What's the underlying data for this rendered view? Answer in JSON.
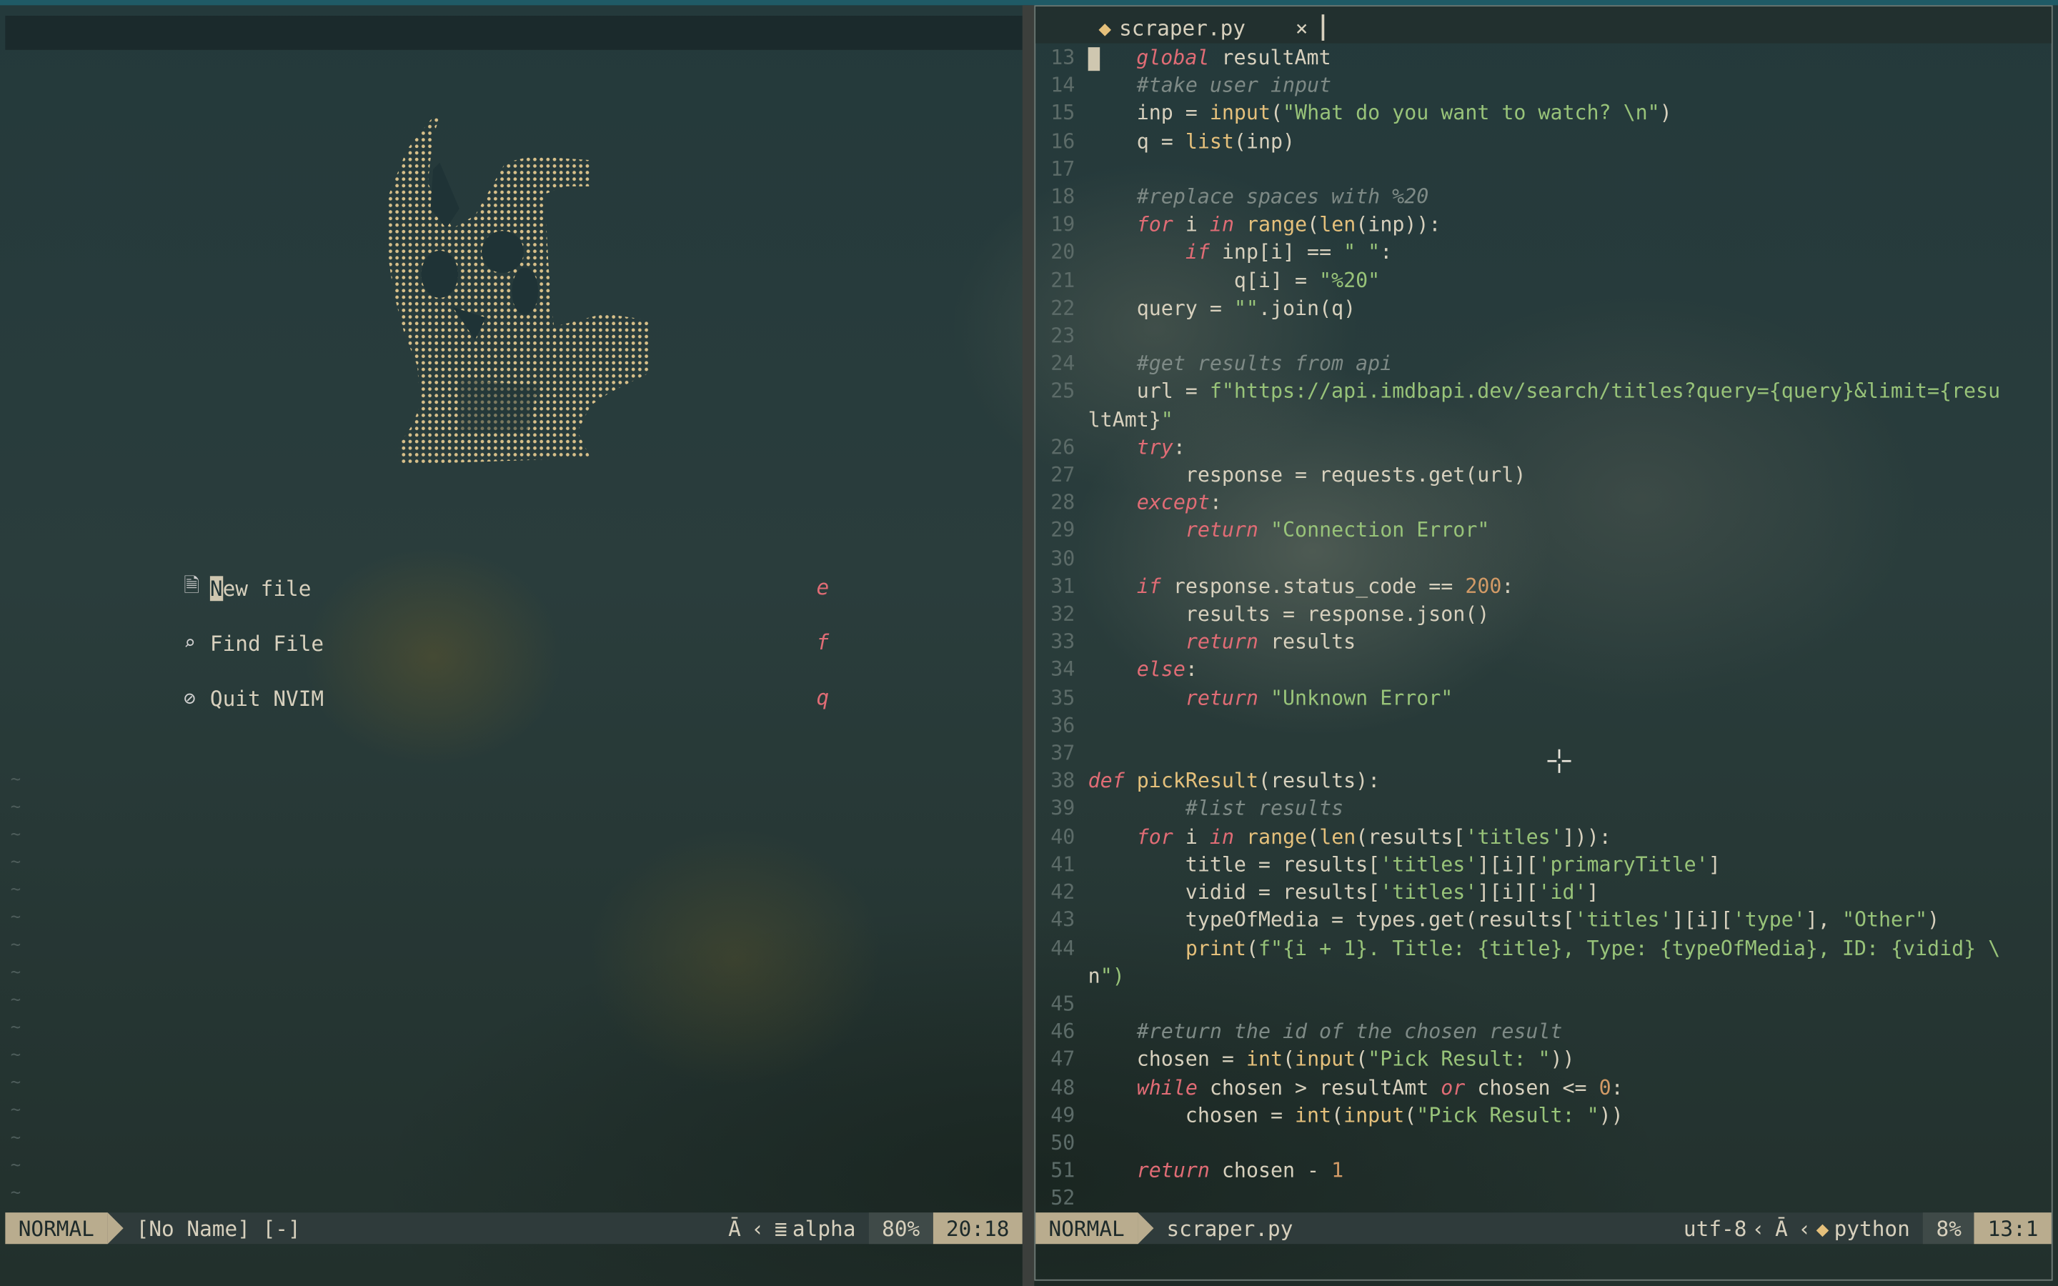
{
  "left_pane": {
    "dashboard": [
      {
        "icon": "file-icon",
        "label": "New file",
        "key": "e"
      },
      {
        "icon": "find-file-icon",
        "label": "Find File",
        "key": "f"
      },
      {
        "icon": "quit-icon",
        "label": "Quit NVIM",
        "key": "q"
      }
    ],
    "status": {
      "mode": "NORMAL",
      "filename": "[No Name] [-]",
      "filetype": "alpha",
      "percent": "80%",
      "position": "20:18"
    }
  },
  "right_pane": {
    "tab": {
      "label": "scraper.py",
      "close": "×"
    },
    "code": [
      {
        "n": "13",
        "text": "    global resultAmt"
      },
      {
        "n": "14",
        "text": "    #take user input"
      },
      {
        "n": "15",
        "text": "    inp = input(\"What do you want to watch? \\n\")"
      },
      {
        "n": "16",
        "text": "    q = list(inp)"
      },
      {
        "n": "17",
        "text": ""
      },
      {
        "n": "18",
        "text": "    #replace spaces with %20"
      },
      {
        "n": "19",
        "text": "    for i in range(len(inp)):"
      },
      {
        "n": "20",
        "text": "        if inp[i] == \" \":"
      },
      {
        "n": "21",
        "text": "            q[i] = \"%20\""
      },
      {
        "n": "22",
        "text": "    query = \"\".join(q)"
      },
      {
        "n": "23",
        "text": ""
      },
      {
        "n": "24",
        "text": "    #get results from api"
      },
      {
        "n": "25",
        "text": "    url = f\"https://api.imdbapi.dev/search/titles?query={query}&limit={resu"
      },
      {
        "n": "",
        "text": "ltAmt}\""
      },
      {
        "n": "26",
        "text": "    try:"
      },
      {
        "n": "27",
        "text": "        response = requests.get(url)"
      },
      {
        "n": "28",
        "text": "    except:"
      },
      {
        "n": "29",
        "text": "        return \"Connection Error\""
      },
      {
        "n": "30",
        "text": ""
      },
      {
        "n": "31",
        "text": "    if response.status_code == 200:"
      },
      {
        "n": "32",
        "text": "        results = response.json()"
      },
      {
        "n": "33",
        "text": "        return results"
      },
      {
        "n": "34",
        "text": "    else:"
      },
      {
        "n": "35",
        "text": "        return \"Unknown Error\""
      },
      {
        "n": "36",
        "text": ""
      },
      {
        "n": "37",
        "text": ""
      },
      {
        "n": "38",
        "text": "def pickResult(results):"
      },
      {
        "n": "39",
        "text": "        #list results"
      },
      {
        "n": "40",
        "text": "    for i in range(len(results['titles'])):"
      },
      {
        "n": "41",
        "text": "        title = results['titles'][i]['primaryTitle']"
      },
      {
        "n": "42",
        "text": "        vidid = results['titles'][i]['id']"
      },
      {
        "n": "43",
        "text": "        typeOfMedia = types.get(results['titles'][i]['type'], \"Other\")"
      },
      {
        "n": "44",
        "text": "        print(f\"{i + 1}. Title: {title}, Type: {typeOfMedia}, ID: {vidid} \\"
      },
      {
        "n": "",
        "text": "n\")"
      },
      {
        "n": "45",
        "text": ""
      },
      {
        "n": "46",
        "text": "    #return the id of the chosen result"
      },
      {
        "n": "47",
        "text": "    chosen = int(input(\"Pick Result: \"))"
      },
      {
        "n": "48",
        "text": "    while chosen > resultAmt or chosen <= 0:"
      },
      {
        "n": "49",
        "text": "        chosen = int(input(\"Pick Result: \"))"
      },
      {
        "n": "50",
        "text": ""
      },
      {
        "n": "51",
        "text": "    return chosen - 1"
      },
      {
        "n": "52",
        "text": ""
      }
    ],
    "status": {
      "mode": "NORMAL",
      "filename": "scraper.py",
      "encoding": "utf-8",
      "filetype": "python",
      "percent": "8%",
      "position": "13:1"
    }
  },
  "colors": {
    "accent": "#b9ac8e",
    "keyword": "#e06c75",
    "string": "#98c379",
    "function": "#e5c07b",
    "comment": "#7e8a86"
  }
}
